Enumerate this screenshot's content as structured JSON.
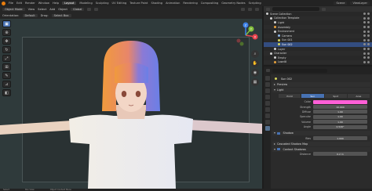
{
  "topbar": {
    "menus": [
      "File",
      "Edit",
      "Render",
      "Window",
      "Help"
    ],
    "workspaces": [
      "Layout",
      "Modeling",
      "Sculpting",
      "UV Editing",
      "Texture Paint",
      "Shading",
      "Animation",
      "Rendering",
      "Compositing",
      "Geometry Nodes",
      "Scripting"
    ],
    "active_workspace": "Layout",
    "scene_label": "Scene",
    "viewlayer_label": "ViewLayer"
  },
  "viewport_header": {
    "mode": "Object Mode",
    "menus": [
      "View",
      "Select",
      "Add",
      "Object"
    ],
    "transform": "Global",
    "orientation_label": "Orientation:",
    "orientation_value": "Default",
    "drag_label": "Drag:",
    "drag_value": "Select Box"
  },
  "gizmo": {
    "axes": [
      "X",
      "Y",
      "Z"
    ],
    "colors": {
      "x": "#e8444e",
      "y": "#84c13c",
      "z": "#3f82e6"
    }
  },
  "outliner": {
    "title": "Scene Collection",
    "items": [
      {
        "label": "Scene Collection",
        "indent": 0,
        "icon_color": "#cfcfcf",
        "selected": false
      },
      {
        "label": "Collection Template",
        "indent": 1,
        "icon_color": "#cfcfcf",
        "selected": false
      },
      {
        "label": "Light",
        "indent": 2,
        "icon_color": "#cfcfcf",
        "selected": false
      },
      {
        "label": "Assembly",
        "indent": 2,
        "icon_color": "#e6a13c",
        "selected": false
      },
      {
        "label": "Environment",
        "indent": 2,
        "icon_color": "#cfcfcf",
        "selected": false
      },
      {
        "label": "Camera",
        "indent": 3,
        "icon_color": "#8fb8e8",
        "selected": false
      },
      {
        "label": "Sun 001",
        "indent": 3,
        "icon_color": "#d6d65c",
        "selected": false
      },
      {
        "label": "Sun 002",
        "indent": 3,
        "icon_color": "#d6d65c",
        "selected": true
      },
      {
        "label": "Layer",
        "indent": 2,
        "icon_color": "#cfcfcf",
        "selected": false
      },
      {
        "label": "Character",
        "indent": 1,
        "icon_color": "#cfcfcf",
        "selected": false
      },
      {
        "label": "Empty",
        "indent": 2,
        "icon_color": "#cfcfcf",
        "selected": false
      },
      {
        "label": "Lowdill",
        "indent": 2,
        "icon_color": "#e6a13c",
        "selected": false
      }
    ]
  },
  "properties": {
    "search_placeholder": "",
    "object_name": "Sun 002",
    "section_preview": "Preview",
    "section_light": "Light",
    "light_types": [
      "Point",
      "Sun",
      "Spot",
      "Area"
    ],
    "active_light_type": "Sun",
    "rows": [
      {
        "label": "Color",
        "value": "",
        "color": "#ff5fd7"
      },
      {
        "label": "Strength",
        "value": "10.000"
      },
      {
        "label": "Diffuse",
        "value": "1.00"
      },
      {
        "label": "Specular",
        "value": "1.00"
      },
      {
        "label": "Volume",
        "value": "1.00"
      },
      {
        "label": "Angle",
        "value": "0.526°"
      }
    ],
    "shadow_label": "Shadow",
    "bias_label": "Bias",
    "bias_value": "1.000",
    "cascaded_label": "Cascaded Shadow Map",
    "contact_label": "Contact Shadows",
    "distance_label": "Distance",
    "distance_value": "0.2 m"
  },
  "statusbar": {
    "items": [
      "Select",
      "Pan View",
      "Object Context Menu"
    ]
  }
}
